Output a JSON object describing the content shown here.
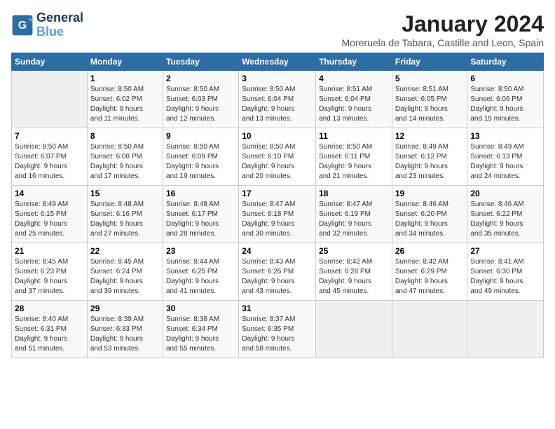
{
  "header": {
    "logo_line1": "General",
    "logo_line2": "Blue",
    "title": "January 2024",
    "location": "Moreruela de Tabara, Castille and Leon, Spain"
  },
  "days_of_week": [
    "Sunday",
    "Monday",
    "Tuesday",
    "Wednesday",
    "Thursday",
    "Friday",
    "Saturday"
  ],
  "weeks": [
    [
      {
        "day": "",
        "empty": true
      },
      {
        "day": "1",
        "sunrise": "Sunrise: 8:50 AM",
        "sunset": "Sunset: 6:02 PM",
        "daylight": "Daylight: 9 hours and 11 minutes."
      },
      {
        "day": "2",
        "sunrise": "Sunrise: 8:50 AM",
        "sunset": "Sunset: 6:03 PM",
        "daylight": "Daylight: 9 hours and 12 minutes."
      },
      {
        "day": "3",
        "sunrise": "Sunrise: 8:50 AM",
        "sunset": "Sunset: 6:04 PM",
        "daylight": "Daylight: 9 hours and 13 minutes."
      },
      {
        "day": "4",
        "sunrise": "Sunrise: 8:51 AM",
        "sunset": "Sunset: 6:04 PM",
        "daylight": "Daylight: 9 hours and 13 minutes."
      },
      {
        "day": "5",
        "sunrise": "Sunrise: 8:51 AM",
        "sunset": "Sunset: 6:05 PM",
        "daylight": "Daylight: 9 hours and 14 minutes."
      },
      {
        "day": "6",
        "sunrise": "Sunrise: 8:50 AM",
        "sunset": "Sunset: 6:06 PM",
        "daylight": "Daylight: 9 hours and 15 minutes."
      }
    ],
    [
      {
        "day": "7",
        "sunrise": "Sunrise: 8:50 AM",
        "sunset": "Sunset: 6:07 PM",
        "daylight": "Daylight: 9 hours and 16 minutes."
      },
      {
        "day": "8",
        "sunrise": "Sunrise: 8:50 AM",
        "sunset": "Sunset: 6:08 PM",
        "daylight": "Daylight: 9 hours and 17 minutes."
      },
      {
        "day": "9",
        "sunrise": "Sunrise: 8:50 AM",
        "sunset": "Sunset: 6:09 PM",
        "daylight": "Daylight: 9 hours and 19 minutes."
      },
      {
        "day": "10",
        "sunrise": "Sunrise: 8:50 AM",
        "sunset": "Sunset: 6:10 PM",
        "daylight": "Daylight: 9 hours and 20 minutes."
      },
      {
        "day": "11",
        "sunrise": "Sunrise: 8:50 AM",
        "sunset": "Sunset: 6:11 PM",
        "daylight": "Daylight: 9 hours and 21 minutes."
      },
      {
        "day": "12",
        "sunrise": "Sunrise: 8:49 AM",
        "sunset": "Sunset: 6:12 PM",
        "daylight": "Daylight: 9 hours and 23 minutes."
      },
      {
        "day": "13",
        "sunrise": "Sunrise: 8:49 AM",
        "sunset": "Sunset: 6:13 PM",
        "daylight": "Daylight: 9 hours and 24 minutes."
      }
    ],
    [
      {
        "day": "14",
        "sunrise": "Sunrise: 8:49 AM",
        "sunset": "Sunset: 6:15 PM",
        "daylight": "Daylight: 9 hours and 25 minutes."
      },
      {
        "day": "15",
        "sunrise": "Sunrise: 8:48 AM",
        "sunset": "Sunset: 6:16 PM",
        "daylight": "Daylight: 9 hours and 27 minutes."
      },
      {
        "day": "16",
        "sunrise": "Sunrise: 8:48 AM",
        "sunset": "Sunset: 6:17 PM",
        "daylight": "Daylight: 9 hours and 28 minutes."
      },
      {
        "day": "17",
        "sunrise": "Sunrise: 8:47 AM",
        "sunset": "Sunset: 6:18 PM",
        "daylight": "Daylight: 9 hours and 30 minutes."
      },
      {
        "day": "18",
        "sunrise": "Sunrise: 8:47 AM",
        "sunset": "Sunset: 6:19 PM",
        "daylight": "Daylight: 9 hours and 32 minutes."
      },
      {
        "day": "19",
        "sunrise": "Sunrise: 8:46 AM",
        "sunset": "Sunset: 6:20 PM",
        "daylight": "Daylight: 9 hours and 34 minutes."
      },
      {
        "day": "20",
        "sunrise": "Sunrise: 8:46 AM",
        "sunset": "Sunset: 6:22 PM",
        "daylight": "Daylight: 9 hours and 35 minutes."
      }
    ],
    [
      {
        "day": "21",
        "sunrise": "Sunrise: 8:45 AM",
        "sunset": "Sunset: 6:23 PM",
        "daylight": "Daylight: 9 hours and 37 minutes."
      },
      {
        "day": "22",
        "sunrise": "Sunrise: 8:45 AM",
        "sunset": "Sunset: 6:24 PM",
        "daylight": "Daylight: 9 hours and 39 minutes."
      },
      {
        "day": "23",
        "sunrise": "Sunrise: 8:44 AM",
        "sunset": "Sunset: 6:25 PM",
        "daylight": "Daylight: 9 hours and 41 minutes."
      },
      {
        "day": "24",
        "sunrise": "Sunrise: 8:43 AM",
        "sunset": "Sunset: 6:26 PM",
        "daylight": "Daylight: 9 hours and 43 minutes."
      },
      {
        "day": "25",
        "sunrise": "Sunrise: 8:42 AM",
        "sunset": "Sunset: 6:28 PM",
        "daylight": "Daylight: 9 hours and 45 minutes."
      },
      {
        "day": "26",
        "sunrise": "Sunrise: 8:42 AM",
        "sunset": "Sunset: 6:29 PM",
        "daylight": "Daylight: 9 hours and 47 minutes."
      },
      {
        "day": "27",
        "sunrise": "Sunrise: 8:41 AM",
        "sunset": "Sunset: 6:30 PM",
        "daylight": "Daylight: 9 hours and 49 minutes."
      }
    ],
    [
      {
        "day": "28",
        "sunrise": "Sunrise: 8:40 AM",
        "sunset": "Sunset: 6:31 PM",
        "daylight": "Daylight: 9 hours and 51 minutes."
      },
      {
        "day": "29",
        "sunrise": "Sunrise: 8:39 AM",
        "sunset": "Sunset: 6:33 PM",
        "daylight": "Daylight: 9 hours and 53 minutes."
      },
      {
        "day": "30",
        "sunrise": "Sunrise: 8:38 AM",
        "sunset": "Sunset: 6:34 PM",
        "daylight": "Daylight: 9 hours and 55 minutes."
      },
      {
        "day": "31",
        "sunrise": "Sunrise: 8:37 AM",
        "sunset": "Sunset: 6:35 PM",
        "daylight": "Daylight: 9 hours and 58 minutes."
      },
      {
        "day": "",
        "empty": true
      },
      {
        "day": "",
        "empty": true
      },
      {
        "day": "",
        "empty": true
      }
    ]
  ]
}
